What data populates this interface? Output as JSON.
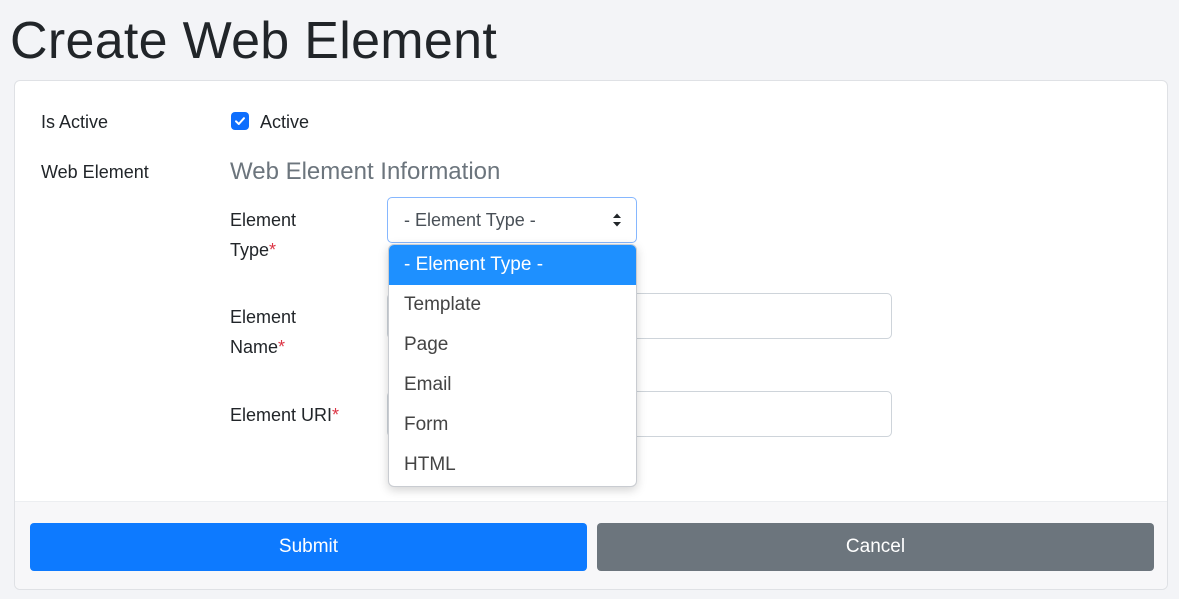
{
  "page": {
    "title": "Create Web Element"
  },
  "form": {
    "is_active": {
      "label": "Is Active",
      "checkbox_label": "Active",
      "checked": true
    },
    "web_element": {
      "label": "Web Element",
      "section_title": "Web Element Information",
      "element_type": {
        "label_line1": "Element",
        "label_line2": "Type",
        "required_mark": "*",
        "selected_value": "- Element Type -",
        "options": [
          "- Element Type -",
          "Template",
          "Page",
          "Email",
          "Form",
          "HTML"
        ]
      },
      "element_name": {
        "label_line1": "Element",
        "label_line2": "Name",
        "required_mark": "*",
        "value": ""
      },
      "element_uri": {
        "label": "Element URI",
        "required_mark": "*",
        "value": ""
      }
    }
  },
  "actions": {
    "submit_label": "Submit",
    "cancel_label": "Cancel"
  },
  "colors": {
    "primary": "#0d7aff",
    "secondary": "#6c757d",
    "highlight": "#1e90ff",
    "required": "#dc3545"
  }
}
